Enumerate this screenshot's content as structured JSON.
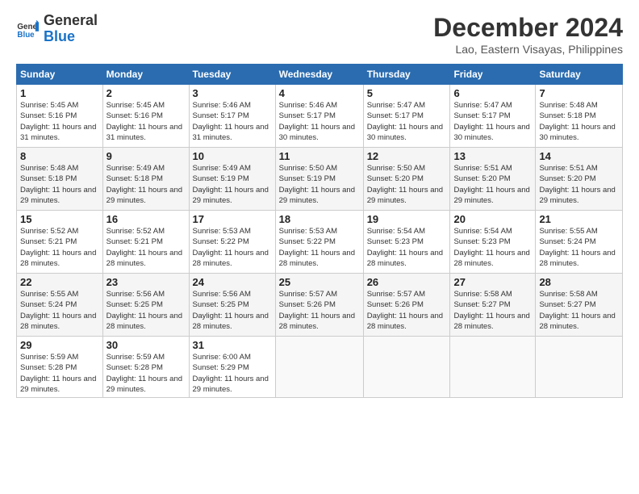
{
  "logo": {
    "line1": "General",
    "line2": "Blue"
  },
  "title": "December 2024",
  "subtitle": "Lao, Eastern Visayas, Philippines",
  "headers": [
    "Sunday",
    "Monday",
    "Tuesday",
    "Wednesday",
    "Thursday",
    "Friday",
    "Saturday"
  ],
  "weeks": [
    [
      {
        "day": "1",
        "sunrise": "5:45 AM",
        "sunset": "5:16 PM",
        "daylight": "11 hours and 31 minutes."
      },
      {
        "day": "2",
        "sunrise": "5:45 AM",
        "sunset": "5:16 PM",
        "daylight": "11 hours and 31 minutes."
      },
      {
        "day": "3",
        "sunrise": "5:46 AM",
        "sunset": "5:17 PM",
        "daylight": "11 hours and 31 minutes."
      },
      {
        "day": "4",
        "sunrise": "5:46 AM",
        "sunset": "5:17 PM",
        "daylight": "11 hours and 30 minutes."
      },
      {
        "day": "5",
        "sunrise": "5:47 AM",
        "sunset": "5:17 PM",
        "daylight": "11 hours and 30 minutes."
      },
      {
        "day": "6",
        "sunrise": "5:47 AM",
        "sunset": "5:17 PM",
        "daylight": "11 hours and 30 minutes."
      },
      {
        "day": "7",
        "sunrise": "5:48 AM",
        "sunset": "5:18 PM",
        "daylight": "11 hours and 30 minutes."
      }
    ],
    [
      {
        "day": "8",
        "sunrise": "5:48 AM",
        "sunset": "5:18 PM",
        "daylight": "11 hours and 29 minutes."
      },
      {
        "day": "9",
        "sunrise": "5:49 AM",
        "sunset": "5:18 PM",
        "daylight": "11 hours and 29 minutes."
      },
      {
        "day": "10",
        "sunrise": "5:49 AM",
        "sunset": "5:19 PM",
        "daylight": "11 hours and 29 minutes."
      },
      {
        "day": "11",
        "sunrise": "5:50 AM",
        "sunset": "5:19 PM",
        "daylight": "11 hours and 29 minutes."
      },
      {
        "day": "12",
        "sunrise": "5:50 AM",
        "sunset": "5:20 PM",
        "daylight": "11 hours and 29 minutes."
      },
      {
        "day": "13",
        "sunrise": "5:51 AM",
        "sunset": "5:20 PM",
        "daylight": "11 hours and 29 minutes."
      },
      {
        "day": "14",
        "sunrise": "5:51 AM",
        "sunset": "5:20 PM",
        "daylight": "11 hours and 29 minutes."
      }
    ],
    [
      {
        "day": "15",
        "sunrise": "5:52 AM",
        "sunset": "5:21 PM",
        "daylight": "11 hours and 28 minutes."
      },
      {
        "day": "16",
        "sunrise": "5:52 AM",
        "sunset": "5:21 PM",
        "daylight": "11 hours and 28 minutes."
      },
      {
        "day": "17",
        "sunrise": "5:53 AM",
        "sunset": "5:22 PM",
        "daylight": "11 hours and 28 minutes."
      },
      {
        "day": "18",
        "sunrise": "5:53 AM",
        "sunset": "5:22 PM",
        "daylight": "11 hours and 28 minutes."
      },
      {
        "day": "19",
        "sunrise": "5:54 AM",
        "sunset": "5:23 PM",
        "daylight": "11 hours and 28 minutes."
      },
      {
        "day": "20",
        "sunrise": "5:54 AM",
        "sunset": "5:23 PM",
        "daylight": "11 hours and 28 minutes."
      },
      {
        "day": "21",
        "sunrise": "5:55 AM",
        "sunset": "5:24 PM",
        "daylight": "11 hours and 28 minutes."
      }
    ],
    [
      {
        "day": "22",
        "sunrise": "5:55 AM",
        "sunset": "5:24 PM",
        "daylight": "11 hours and 28 minutes."
      },
      {
        "day": "23",
        "sunrise": "5:56 AM",
        "sunset": "5:25 PM",
        "daylight": "11 hours and 28 minutes."
      },
      {
        "day": "24",
        "sunrise": "5:56 AM",
        "sunset": "5:25 PM",
        "daylight": "11 hours and 28 minutes."
      },
      {
        "day": "25",
        "sunrise": "5:57 AM",
        "sunset": "5:26 PM",
        "daylight": "11 hours and 28 minutes."
      },
      {
        "day": "26",
        "sunrise": "5:57 AM",
        "sunset": "5:26 PM",
        "daylight": "11 hours and 28 minutes."
      },
      {
        "day": "27",
        "sunrise": "5:58 AM",
        "sunset": "5:27 PM",
        "daylight": "11 hours and 28 minutes."
      },
      {
        "day": "28",
        "sunrise": "5:58 AM",
        "sunset": "5:27 PM",
        "daylight": "11 hours and 28 minutes."
      }
    ],
    [
      {
        "day": "29",
        "sunrise": "5:59 AM",
        "sunset": "5:28 PM",
        "daylight": "11 hours and 29 minutes."
      },
      {
        "day": "30",
        "sunrise": "5:59 AM",
        "sunset": "5:28 PM",
        "daylight": "11 hours and 29 minutes."
      },
      {
        "day": "31",
        "sunrise": "6:00 AM",
        "sunset": "5:29 PM",
        "daylight": "11 hours and 29 minutes."
      },
      null,
      null,
      null,
      null
    ]
  ]
}
